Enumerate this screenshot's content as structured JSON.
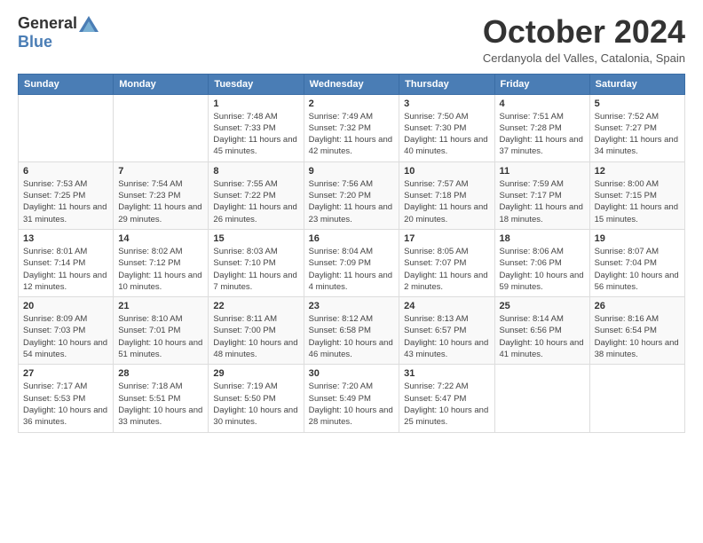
{
  "header": {
    "logo_general": "General",
    "logo_blue": "Blue",
    "month_title": "October 2024",
    "subtitle": "Cerdanyola del Valles, Catalonia, Spain"
  },
  "days_of_week": [
    "Sunday",
    "Monday",
    "Tuesday",
    "Wednesday",
    "Thursday",
    "Friday",
    "Saturday"
  ],
  "weeks": [
    [
      {
        "day": "",
        "sunrise": "",
        "sunset": "",
        "daylight": ""
      },
      {
        "day": "",
        "sunrise": "",
        "sunset": "",
        "daylight": ""
      },
      {
        "day": "1",
        "sunrise": "Sunrise: 7:48 AM",
        "sunset": "Sunset: 7:33 PM",
        "daylight": "Daylight: 11 hours and 45 minutes."
      },
      {
        "day": "2",
        "sunrise": "Sunrise: 7:49 AM",
        "sunset": "Sunset: 7:32 PM",
        "daylight": "Daylight: 11 hours and 42 minutes."
      },
      {
        "day": "3",
        "sunrise": "Sunrise: 7:50 AM",
        "sunset": "Sunset: 7:30 PM",
        "daylight": "Daylight: 11 hours and 40 minutes."
      },
      {
        "day": "4",
        "sunrise": "Sunrise: 7:51 AM",
        "sunset": "Sunset: 7:28 PM",
        "daylight": "Daylight: 11 hours and 37 minutes."
      },
      {
        "day": "5",
        "sunrise": "Sunrise: 7:52 AM",
        "sunset": "Sunset: 7:27 PM",
        "daylight": "Daylight: 11 hours and 34 minutes."
      }
    ],
    [
      {
        "day": "6",
        "sunrise": "Sunrise: 7:53 AM",
        "sunset": "Sunset: 7:25 PM",
        "daylight": "Daylight: 11 hours and 31 minutes."
      },
      {
        "day": "7",
        "sunrise": "Sunrise: 7:54 AM",
        "sunset": "Sunset: 7:23 PM",
        "daylight": "Daylight: 11 hours and 29 minutes."
      },
      {
        "day": "8",
        "sunrise": "Sunrise: 7:55 AM",
        "sunset": "Sunset: 7:22 PM",
        "daylight": "Daylight: 11 hours and 26 minutes."
      },
      {
        "day": "9",
        "sunrise": "Sunrise: 7:56 AM",
        "sunset": "Sunset: 7:20 PM",
        "daylight": "Daylight: 11 hours and 23 minutes."
      },
      {
        "day": "10",
        "sunrise": "Sunrise: 7:57 AM",
        "sunset": "Sunset: 7:18 PM",
        "daylight": "Daylight: 11 hours and 20 minutes."
      },
      {
        "day": "11",
        "sunrise": "Sunrise: 7:59 AM",
        "sunset": "Sunset: 7:17 PM",
        "daylight": "Daylight: 11 hours and 18 minutes."
      },
      {
        "day": "12",
        "sunrise": "Sunrise: 8:00 AM",
        "sunset": "Sunset: 7:15 PM",
        "daylight": "Daylight: 11 hours and 15 minutes."
      }
    ],
    [
      {
        "day": "13",
        "sunrise": "Sunrise: 8:01 AM",
        "sunset": "Sunset: 7:14 PM",
        "daylight": "Daylight: 11 hours and 12 minutes."
      },
      {
        "day": "14",
        "sunrise": "Sunrise: 8:02 AM",
        "sunset": "Sunset: 7:12 PM",
        "daylight": "Daylight: 11 hours and 10 minutes."
      },
      {
        "day": "15",
        "sunrise": "Sunrise: 8:03 AM",
        "sunset": "Sunset: 7:10 PM",
        "daylight": "Daylight: 11 hours and 7 minutes."
      },
      {
        "day": "16",
        "sunrise": "Sunrise: 8:04 AM",
        "sunset": "Sunset: 7:09 PM",
        "daylight": "Daylight: 11 hours and 4 minutes."
      },
      {
        "day": "17",
        "sunrise": "Sunrise: 8:05 AM",
        "sunset": "Sunset: 7:07 PM",
        "daylight": "Daylight: 11 hours and 2 minutes."
      },
      {
        "day": "18",
        "sunrise": "Sunrise: 8:06 AM",
        "sunset": "Sunset: 7:06 PM",
        "daylight": "Daylight: 10 hours and 59 minutes."
      },
      {
        "day": "19",
        "sunrise": "Sunrise: 8:07 AM",
        "sunset": "Sunset: 7:04 PM",
        "daylight": "Daylight: 10 hours and 56 minutes."
      }
    ],
    [
      {
        "day": "20",
        "sunrise": "Sunrise: 8:09 AM",
        "sunset": "Sunset: 7:03 PM",
        "daylight": "Daylight: 10 hours and 54 minutes."
      },
      {
        "day": "21",
        "sunrise": "Sunrise: 8:10 AM",
        "sunset": "Sunset: 7:01 PM",
        "daylight": "Daylight: 10 hours and 51 minutes."
      },
      {
        "day": "22",
        "sunrise": "Sunrise: 8:11 AM",
        "sunset": "Sunset: 7:00 PM",
        "daylight": "Daylight: 10 hours and 48 minutes."
      },
      {
        "day": "23",
        "sunrise": "Sunrise: 8:12 AM",
        "sunset": "Sunset: 6:58 PM",
        "daylight": "Daylight: 10 hours and 46 minutes."
      },
      {
        "day": "24",
        "sunrise": "Sunrise: 8:13 AM",
        "sunset": "Sunset: 6:57 PM",
        "daylight": "Daylight: 10 hours and 43 minutes."
      },
      {
        "day": "25",
        "sunrise": "Sunrise: 8:14 AM",
        "sunset": "Sunset: 6:56 PM",
        "daylight": "Daylight: 10 hours and 41 minutes."
      },
      {
        "day": "26",
        "sunrise": "Sunrise: 8:16 AM",
        "sunset": "Sunset: 6:54 PM",
        "daylight": "Daylight: 10 hours and 38 minutes."
      }
    ],
    [
      {
        "day": "27",
        "sunrise": "Sunrise: 7:17 AM",
        "sunset": "Sunset: 5:53 PM",
        "daylight": "Daylight: 10 hours and 36 minutes."
      },
      {
        "day": "28",
        "sunrise": "Sunrise: 7:18 AM",
        "sunset": "Sunset: 5:51 PM",
        "daylight": "Daylight: 10 hours and 33 minutes."
      },
      {
        "day": "29",
        "sunrise": "Sunrise: 7:19 AM",
        "sunset": "Sunset: 5:50 PM",
        "daylight": "Daylight: 10 hours and 30 minutes."
      },
      {
        "day": "30",
        "sunrise": "Sunrise: 7:20 AM",
        "sunset": "Sunset: 5:49 PM",
        "daylight": "Daylight: 10 hours and 28 minutes."
      },
      {
        "day": "31",
        "sunrise": "Sunrise: 7:22 AM",
        "sunset": "Sunset: 5:47 PM",
        "daylight": "Daylight: 10 hours and 25 minutes."
      },
      {
        "day": "",
        "sunrise": "",
        "sunset": "",
        "daylight": ""
      },
      {
        "day": "",
        "sunrise": "",
        "sunset": "",
        "daylight": ""
      }
    ]
  ]
}
